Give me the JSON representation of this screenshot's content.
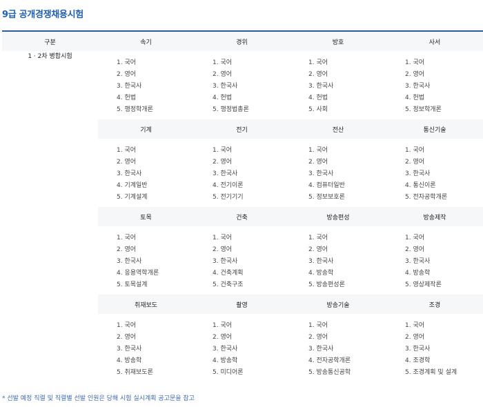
{
  "title": "9급 공개경쟁채용시험",
  "table": {
    "header_category": "구분",
    "group_label": "1 · 2차 병합시험",
    "blocks": [
      {
        "fields": [
          "속기",
          "경위",
          "방호",
          "사서"
        ],
        "subjects": [
          [
            "1. 국어",
            "2. 영어",
            "3. 한국사",
            "4. 헌법",
            "5. 행정학개론"
          ],
          [
            "1. 국어",
            "2. 영어",
            "3. 한국사",
            "4. 헌법",
            "5. 행정법총론"
          ],
          [
            "1. 국어",
            "2. 영어",
            "3. 한국사",
            "4. 헌법",
            "5. 사회"
          ],
          [
            "1. 국어",
            "2. 영어",
            "3. 한국사",
            "4. 헌법",
            "5. 정보학개론"
          ]
        ]
      },
      {
        "fields": [
          "기계",
          "전기",
          "전산",
          "통신기술"
        ],
        "subjects": [
          [
            "1. 국어",
            "2. 영어",
            "3. 한국사",
            "4. 기계일반",
            "5. 기계설계"
          ],
          [
            "1. 국어",
            "2. 영어",
            "3. 한국사",
            "4. 전기이론",
            "5. 전기기기"
          ],
          [
            "1. 국어",
            "2. 영어",
            "3. 한국사",
            "4. 컴퓨터일반",
            "5. 정보보호론"
          ],
          [
            "1. 국어",
            "2. 영어",
            "3. 한국사",
            "4. 통신이론",
            "5. 전자공학개론"
          ]
        ]
      },
      {
        "fields": [
          "토목",
          "건축",
          "방송편성",
          "방송제작"
        ],
        "subjects": [
          [
            "1. 국어",
            "2. 영어",
            "3. 한국사",
            "4. 응용역학개론",
            "5. 토목설계"
          ],
          [
            "1. 국어",
            "2. 영어",
            "3. 한국사",
            "4. 건축계획",
            "5. 건축구조"
          ],
          [
            "1. 국어",
            "2. 영어",
            "3. 한국사",
            "4. 방송학",
            "5. 방송편성론"
          ],
          [
            "1. 국어",
            "2. 영어",
            "3. 한국사",
            "4. 방송학",
            "5. 영상제작론"
          ]
        ]
      },
      {
        "fields": [
          "취재보도",
          "촬영",
          "방송기술",
          "조경"
        ],
        "subjects": [
          [
            "1. 국어",
            "2. 영어",
            "3. 한국사",
            "4. 방송학",
            "5. 취재보도론"
          ],
          [
            "1. 국어",
            "2. 영어",
            "3. 한국사",
            "4. 방송학",
            "5. 미디어론"
          ],
          [
            "1. 국어",
            "2. 영어",
            "3. 한국사",
            "4. 전자공학개론",
            "5. 방송통신공학"
          ],
          [
            "1. 국어",
            "2. 영어",
            "3. 한국사",
            "4. 조경학",
            "5. 조경계획 및 설계"
          ]
        ]
      }
    ]
  },
  "note": "* 선발 예정 직렬 및 직렬별 선발 인원은 당해 시험 실시계획 공고문을 참고"
}
